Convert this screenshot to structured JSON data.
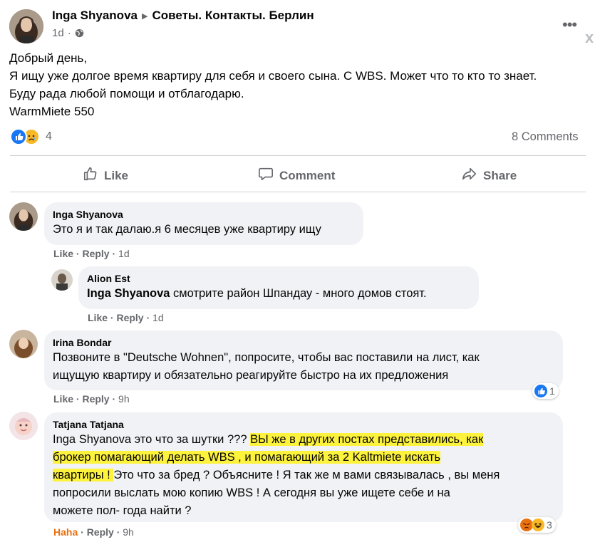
{
  "post": {
    "author": "Inga Shyanova",
    "group": "Советы. Контакты. Берлин",
    "time": "1d",
    "lines": [
      "Добрый день,",
      "Я ищу уже долгое время квартиру для себя и своего сына. С WBS. Может что то кто то знает.",
      "Буду рада любой помощи и отблагодарю.",
      "WarmMiete 550"
    ],
    "reaction_count": "4",
    "comments_count": "8 Comments",
    "actions": {
      "like": "Like",
      "comment": "Comment",
      "share": "Share"
    },
    "close": "x"
  },
  "comments": [
    {
      "author": "Inga Shyanova",
      "text": "Это я и так далаю.я 6 месяцев уже квартиру ищу",
      "like": "Like",
      "reply": "Reply",
      "time": "1d"
    },
    {
      "author": "Alion Est",
      "mention": "Inga Shyanova",
      "text": " смотрите район Шпандау - много домов стоят.",
      "like": "Like",
      "reply": "Reply",
      "time": "1d"
    },
    {
      "author": "Irina Bondar",
      "lines": [
        "Позвоните в \"Deutsche Wohnen\", попросите, чтобы вас поставили на лист, как",
        "ищущую квартиру и обязательно реагируйте быстро на их предложения"
      ],
      "like": "Like",
      "reply": "Reply",
      "time": "9h",
      "reaction_count": "1"
    },
    {
      "author": "Tatjana Tatjana",
      "l1_plain": "Inga Shyanova это что за шутки ??? ",
      "l1_hl": "ВЫ же в других постах представились, как",
      "l2_hl": "брокер помагающий делать WBS , и помагающий за 2 Kaltmiete искать",
      "l3_hl": "квартиры ! ",
      "l3_plain": "Это что за бред ? Объясните ! Я так же м вами связывалась , вы меня",
      "l4": "попросили выслать мою копию WBS ! А сегодня вы уже ищете себе и на",
      "l5": "можете пол- года найти ?",
      "reaction_label": "Haha",
      "reply": "Reply",
      "time": "9h",
      "reaction_count": "3"
    }
  ],
  "colors": {
    "accent": "#1877f2",
    "highlight": "#fdf23c",
    "haha": "#e9710f",
    "bubble": "#f0f2f5"
  }
}
